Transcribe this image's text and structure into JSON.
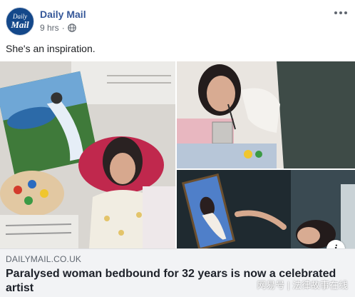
{
  "post": {
    "page_name": "Daily Mail",
    "avatar_top": "Daily",
    "avatar_bottom": "Mail",
    "time": "9 hrs",
    "separator": "·",
    "privacy_icon": "globe-icon",
    "more_icon": "more-options-icon",
    "text": "She's an inspiration."
  },
  "link": {
    "domain": "DAILYMAIL.CO.UK",
    "title": "Paralysed woman bedbound for 32 years is now a celebrated artist",
    "info_label": "i"
  },
  "watermark": "网易号 | 法律故事在线",
  "colors": {
    "brand_blue": "#365899",
    "avatar_bg": "#14488a",
    "card_bg": "#f2f3f5"
  }
}
